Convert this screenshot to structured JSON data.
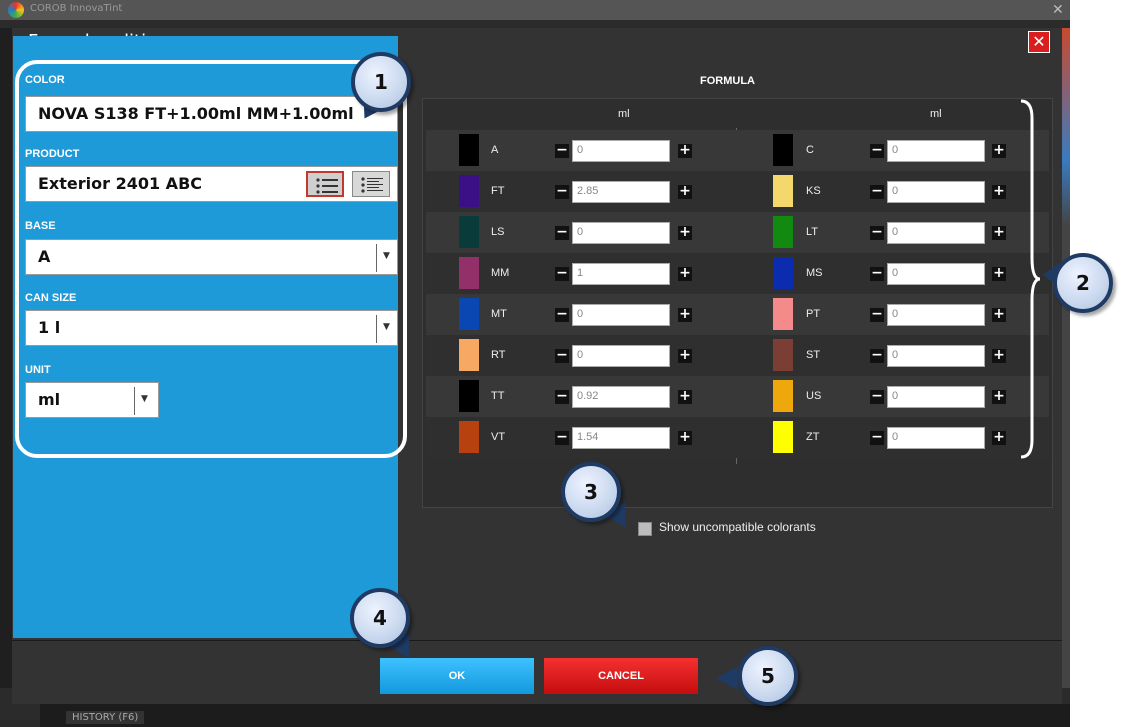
{
  "app": {
    "title": "COROB InnovaTint",
    "history_tab": "HISTORY (F6)"
  },
  "dialog": {
    "title": "Formula editing",
    "close_symbol": "✕"
  },
  "fields": {
    "color": {
      "label": "COLOR",
      "value": "NOVA S138 FT+1.00ml MM+1.00ml"
    },
    "product": {
      "label": "PRODUCT",
      "value": "Exterior 2401 ABC"
    },
    "base": {
      "label": "BASE",
      "value": "A"
    },
    "can_size": {
      "label": "CAN SIZE",
      "value": "1 l"
    },
    "unit": {
      "label": "UNIT",
      "value": "ml"
    }
  },
  "formula": {
    "title": "FORMULA",
    "left_unit": "ml",
    "right_unit": "ml",
    "left": [
      {
        "code": "A",
        "value": "0",
        "color": "#000000"
      },
      {
        "code": "FT",
        "value": "2.85",
        "color": "#3b0f86"
      },
      {
        "code": "LS",
        "value": "0",
        "color": "#0a3b3b"
      },
      {
        "code": "MM",
        "value": "1",
        "color": "#93306a"
      },
      {
        "code": "MT",
        "value": "0",
        "color": "#0a47b3"
      },
      {
        "code": "RT",
        "value": "0",
        "color": "#f7a863"
      },
      {
        "code": "TT",
        "value": "0.92",
        "color": "#000000"
      },
      {
        "code": "VT",
        "value": "1.54",
        "color": "#b8420f"
      }
    ],
    "right": [
      {
        "code": "C",
        "value": "0",
        "color": "#000000"
      },
      {
        "code": "KS",
        "value": "0",
        "color": "#f5d86c"
      },
      {
        "code": "LT",
        "value": "0",
        "color": "#128a12"
      },
      {
        "code": "MS",
        "value": "0",
        "color": "#0b2cae"
      },
      {
        "code": "PT",
        "value": "0",
        "color": "#f58a8a"
      },
      {
        "code": "ST",
        "value": "0",
        "color": "#7a3e35"
      },
      {
        "code": "US",
        "value": "0",
        "color": "#efa80c"
      },
      {
        "code": "ZT",
        "value": "0",
        "color": "#ffff00"
      }
    ]
  },
  "show_uncompatible": {
    "label": "Show uncompatible colorants",
    "checked": false
  },
  "buttons": {
    "ok": "OK",
    "cancel": "CANCEL"
  },
  "callouts": [
    "1",
    "2",
    "3",
    "4",
    "5"
  ]
}
